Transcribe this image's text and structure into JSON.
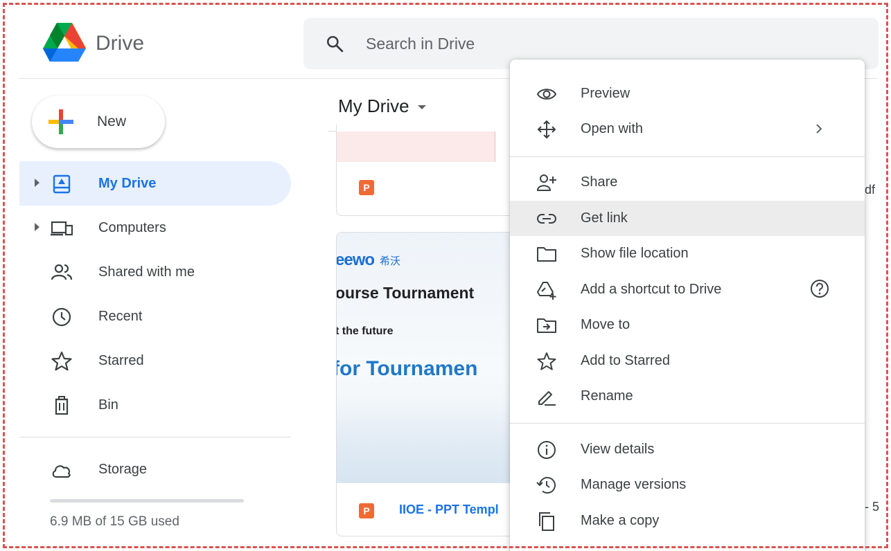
{
  "header": {
    "brand": "Drive",
    "search_placeholder": "Search in Drive"
  },
  "sidebar": {
    "new_label": "New",
    "items": [
      {
        "label": "My Drive",
        "icon": "my-drive-icon",
        "active": true
      },
      {
        "label": "Computers",
        "icon": "computers-icon"
      },
      {
        "label": "Shared with me",
        "icon": "shared-icon"
      },
      {
        "label": "Recent",
        "icon": "clock-icon"
      },
      {
        "label": "Starred",
        "icon": "star-icon"
      },
      {
        "label": "Bin",
        "icon": "trash-icon"
      }
    ],
    "storage_label": "Storage",
    "storage_used": "6.9 MB of 15 GB used"
  },
  "main": {
    "title": "My Drive",
    "card1_badge": "P",
    "card2": {
      "brand": "eewo",
      "brand_cn": "希沃",
      "course": "ourse Tournament",
      "future": "t the future",
      "tournament": "for Tournamen",
      "badge": "P",
      "filename": "IIOE - PPT Templ"
    },
    "right_fragments": [
      "df",
      "- 5"
    ]
  },
  "context_menu": {
    "items": [
      {
        "label": "Preview",
        "icon": "eye-icon"
      },
      {
        "label": "Open with",
        "icon": "move-arrows-icon",
        "submenu": true
      },
      {
        "label": "Share",
        "icon": "person-add-icon"
      },
      {
        "label": "Get link",
        "icon": "link-icon",
        "highlighted": true
      },
      {
        "label": "Show file location",
        "icon": "folder-icon"
      },
      {
        "label": "Add a shortcut to Drive",
        "icon": "add-shortcut-icon",
        "help": true
      },
      {
        "label": "Move to",
        "icon": "move-to-icon"
      },
      {
        "label": "Add to Starred",
        "icon": "star-outline-icon"
      },
      {
        "label": "Rename",
        "icon": "pencil-icon"
      },
      {
        "label": "View details",
        "icon": "info-icon"
      },
      {
        "label": "Manage versions",
        "icon": "history-icon"
      },
      {
        "label": "Make a copy",
        "icon": "copy-icon"
      }
    ]
  },
  "colors": {
    "accent": "#1a73e8",
    "active_bg": "#e8f0fe",
    "menu_highlight": "#ececec",
    "border_dashed": "#d9534f"
  }
}
